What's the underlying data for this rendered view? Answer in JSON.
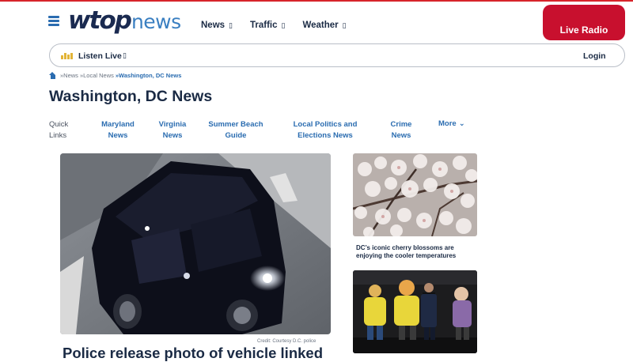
{
  "header": {
    "logo_main": "wtop",
    "logo_sub": "news",
    "nav": [
      {
        "label": "News",
        "caret": "▯"
      },
      {
        "label": "Traffic",
        "caret": "▯"
      },
      {
        "label": "Weather",
        "caret": "▯"
      }
    ],
    "live_radio_label": "Live Radio"
  },
  "listen_bar": {
    "label": "Listen Live",
    "caret": "▯",
    "login_label": "Login"
  },
  "breadcrumb": [
    "»News",
    "»Local News",
    "»Washington, DC News"
  ],
  "page_title": "Washington, DC News",
  "quick_links": {
    "label_line1": "Quick",
    "label_line2": "Links",
    "items": [
      {
        "line1": "Maryland",
        "line2": "News"
      },
      {
        "line1": "Virginia",
        "line2": "News"
      },
      {
        "line1": "Summer Beach",
        "line2": "Guide"
      },
      {
        "line1": "Local Politics and",
        "line2": "Elections News"
      },
      {
        "line1": "Crime",
        "line2": "News"
      }
    ],
    "more_label": "More",
    "more_caret": "⌄"
  },
  "main_story": {
    "credit": "Credit: Courtesy D.C. police",
    "headline": "Police release photo of vehicle linked"
  },
  "side_stories": [
    {
      "caption": "DC’s iconic cherry blossoms are enjoying the cooler temperatures"
    }
  ],
  "colors": {
    "brand_red": "#c8102e",
    "link_blue": "#2a6cb0",
    "text_dark": "#1a2a44"
  }
}
